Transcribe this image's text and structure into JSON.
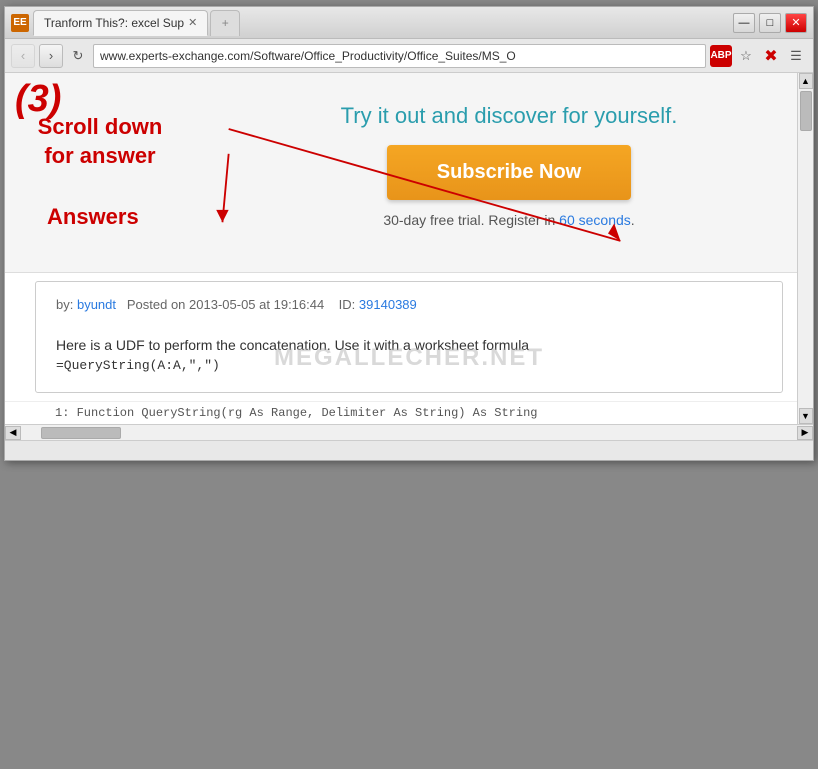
{
  "window": {
    "title": "Tranform This?: excel Sup",
    "titlebar_icon": "EE",
    "controls": {
      "minimize": "—",
      "maximize": "□",
      "close": "✕"
    }
  },
  "tab": {
    "label": "Tranform This?: excel Sup",
    "favicon": "EE"
  },
  "addressbar": {
    "url": "www.experts-exchange.com/Software/Office_Productivity/Office_Suites/MS_O",
    "back_label": "‹",
    "forward_label": "›",
    "refresh_label": "↻"
  },
  "toolbar_icons": [
    "ABP",
    "☆",
    "✖",
    "☰"
  ],
  "annotation": {
    "number": "(3)",
    "text": "Scroll down\nfor answer",
    "answers_label": "Answers"
  },
  "main_content": {
    "headline": "Try it out and discover for yourself.",
    "subscribe_button": "Subscribe Now",
    "trial_text": "30-day free trial. Register in ",
    "trial_link": "60 seconds",
    "trial_suffix": "."
  },
  "answers_section": {
    "by_label": "by:",
    "username": "byundt",
    "posted_label": "Posted on",
    "date": "2013-05-05",
    "time": "19:16:44",
    "id_label": "ID:",
    "id_value": "39140389",
    "body_text": "Here is a UDF to perform the concatenation. Use it with a worksheet formula",
    "formula": "=QueryString(A:A,\",\")",
    "code_line": "1: Function QueryString(rg As Range, Delimiter As String) As String"
  },
  "watermark": "MEGALLECHER.NET",
  "statusbar": {
    "text": ""
  }
}
